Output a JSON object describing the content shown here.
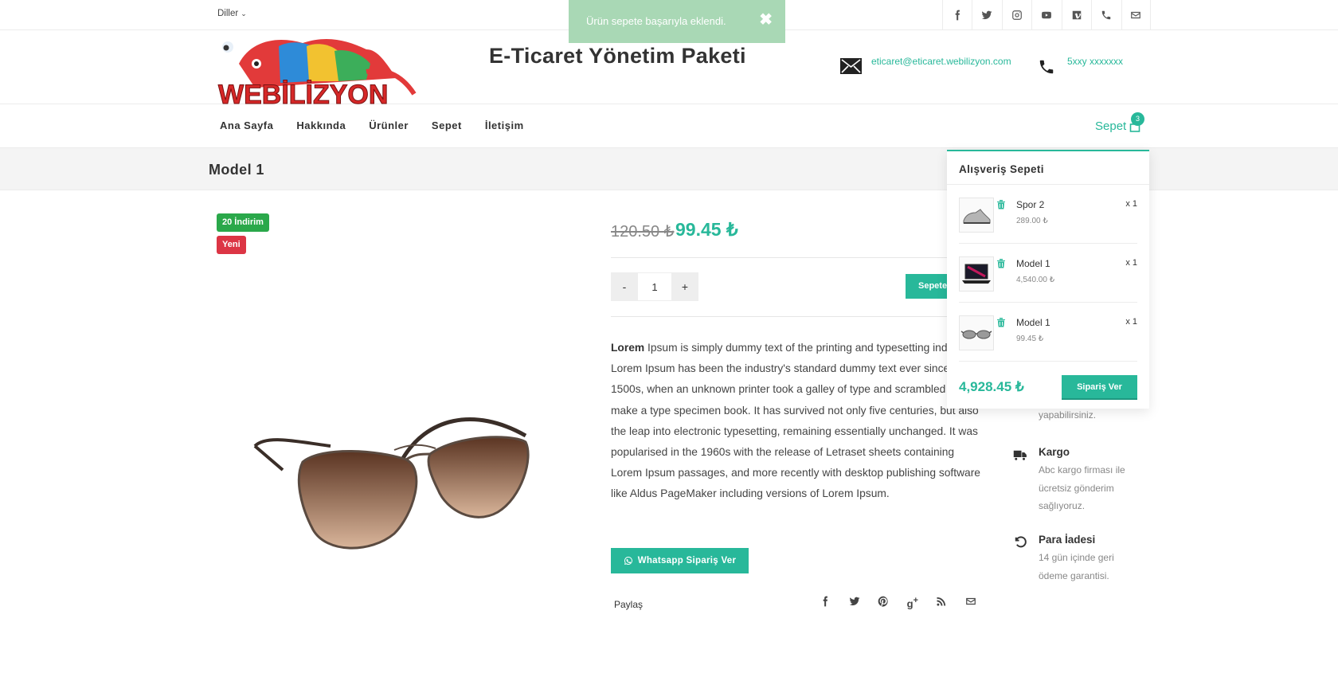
{
  "topbar": {
    "language_label": "Diller",
    "socials": [
      "facebook-icon",
      "twitter-icon",
      "instagram-icon",
      "youtube-icon",
      "vimeo-icon",
      "phone-icon",
      "mail-icon"
    ]
  },
  "toast": {
    "message": "Ürün sepete başarıyla eklendi.",
    "close": "✖"
  },
  "header": {
    "site_title": "E-Ticaret Yönetim Paketi",
    "email": "eticaret@eticaret.webilizyon.com",
    "phone": "5xxy xxxxxxx",
    "logo_text": "WEBİLİZYON"
  },
  "nav": {
    "items": [
      "Ana Sayfa",
      "Hakkında",
      "Ürünler",
      "Sepet",
      "İletişim"
    ],
    "cart_label": "Sepet",
    "cart_count": "3"
  },
  "page": {
    "title": "Model 1"
  },
  "product": {
    "badge_discount": "20 İndirim",
    "badge_new": "Yeni",
    "old_price": "120.50 ₺",
    "new_price": "99.45 ₺",
    "qty_minus": "-",
    "qty_value": "1",
    "qty_plus": "+",
    "add_to_cart": "Sepete",
    "desc_bold": "Lorem",
    "description": " Ipsum is simply dummy text of the printing and typesetting industry. Lorem Ipsum has been the industry's standard dummy text ever since the 1500s, when an unknown printer took a galley of type and scrambled it to make a type specimen book. It has survived not only five centuries, but also the leap into electronic typesetting, remaining essentially unchanged. It was popularised in the 1960s with the release of Letraset sheets containing Lorem Ipsum passages, and more recently with desktop publishing software like Aldus PageMaker including versions of Lorem Ipsum.",
    "whatsapp_button": "Whatsapp Sipariş Ver",
    "share_label": "Paylaş",
    "share_icons": [
      "facebook-icon",
      "twitter-icon",
      "pinterest-icon",
      "google-plus-icon",
      "rss-icon",
      "mail-icon"
    ]
  },
  "features": [
    {
      "partial": "yapabilirsiniz."
    },
    {
      "title": "Kargo",
      "desc": "Abc kargo firması ile ücretsiz gönderim sağlıyoruz.",
      "icon": "truck-icon"
    },
    {
      "title": "Para İadesi",
      "desc": "14 gün içinde geri ödeme garantisi.",
      "icon": "undo-icon"
    }
  ],
  "cart_dropdown": {
    "title": "Alışveriş Sepeti",
    "items": [
      {
        "name": "Spor 2",
        "price": "289.00 ₺",
        "qty": "x 1",
        "thumb": "sneaker"
      },
      {
        "name": "Model 1",
        "price": "4,540.00 ₺",
        "qty": "x 1",
        "thumb": "laptop"
      },
      {
        "name": "Model 1",
        "price": "99.45 ₺",
        "qty": "x 1",
        "thumb": "sunglasses"
      }
    ],
    "total": "4,928.45 ₺",
    "checkout_button": "Sipariş Ver"
  },
  "colors": {
    "accent": "#28b89a",
    "badge_green": "#2aa84a",
    "badge_red": "#dc3545",
    "toast_bg": "#a9d8b5"
  }
}
